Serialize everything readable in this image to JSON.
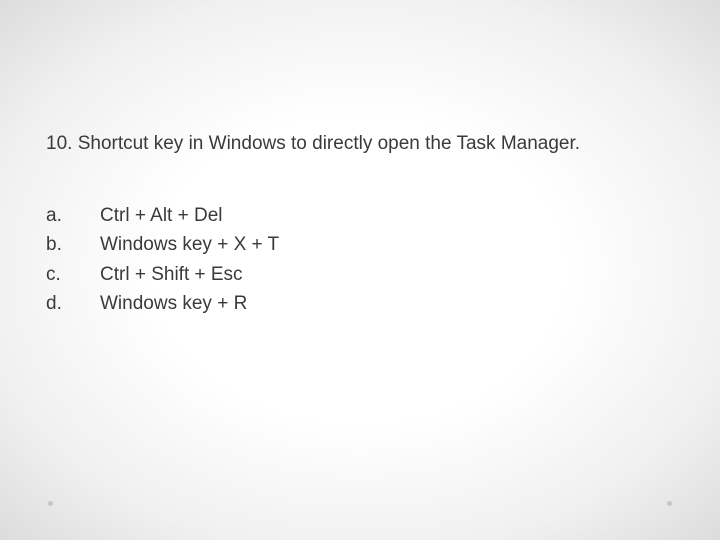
{
  "question": {
    "number": "10.",
    "text": "Shortcut key in Windows to directly open the Task Manager."
  },
  "options": [
    {
      "letter": "a.",
      "text": "Ctrl + Alt + Del"
    },
    {
      "letter": "b.",
      "text": "Windows key + X + T"
    },
    {
      "letter": "c.",
      "text": "Ctrl + Shift + Esc"
    },
    {
      "letter": "d.",
      "text": "Windows key + R"
    }
  ]
}
